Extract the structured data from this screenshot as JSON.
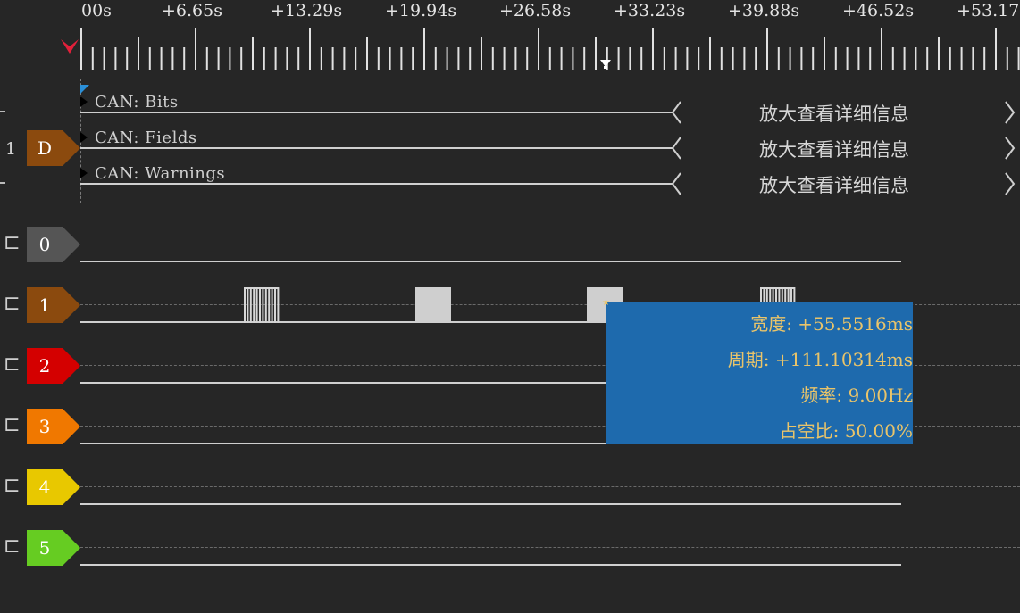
{
  "ruler": {
    "labels": [
      "00s",
      "+6.65s",
      "+13.29s",
      "+19.94s",
      "+26.58s",
      "+33.23s",
      "+39.88s",
      "+46.52s",
      "+53.17"
    ]
  },
  "decoder_group": {
    "index": "1",
    "tag": "D",
    "tag_color": "#8B4A0E",
    "rows": [
      {
        "label": "CAN: Bits",
        "zoom_msg": "放大查看详细信息"
      },
      {
        "label": "CAN: Fields",
        "zoom_msg": "放大查看详细信息"
      },
      {
        "label": "CAN: Warnings",
        "zoom_msg": "放大查看详细信息"
      }
    ]
  },
  "channels": [
    {
      "label": "0",
      "color": "#555555"
    },
    {
      "label": "1",
      "color": "#8B4A0E"
    },
    {
      "label": "2",
      "color": "#D40000"
    },
    {
      "label": "3",
      "color": "#F07800"
    },
    {
      "label": "4",
      "color": "#E8C800"
    },
    {
      "label": "5",
      "color": "#66CC22"
    }
  ],
  "measurement": {
    "width": "宽度: +55.5516ms",
    "period": "周期: +111.10314ms",
    "frequency": "频率: 9.00Hz",
    "duty": "占空比: 50.00%"
  },
  "icons": {
    "trigger": "trigger-marker-icon",
    "cursor": "cursor-marker-icon",
    "bracket": "channel-bracket-icon"
  }
}
